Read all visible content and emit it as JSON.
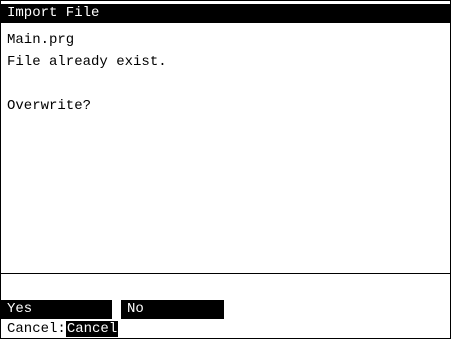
{
  "dialog": {
    "title": "Import File",
    "file_name": "Main.prg",
    "message": "File already exist.",
    "question": "Overwrite?"
  },
  "softkeys": {
    "yes_label": "Yes",
    "no_label": "No",
    "cancel_prefix": "Cancel:",
    "cancel_label": "Cancel"
  },
  "colors": {
    "background": "#ffffff",
    "foreground": "#000000",
    "inverse_text": "#ffffff"
  }
}
